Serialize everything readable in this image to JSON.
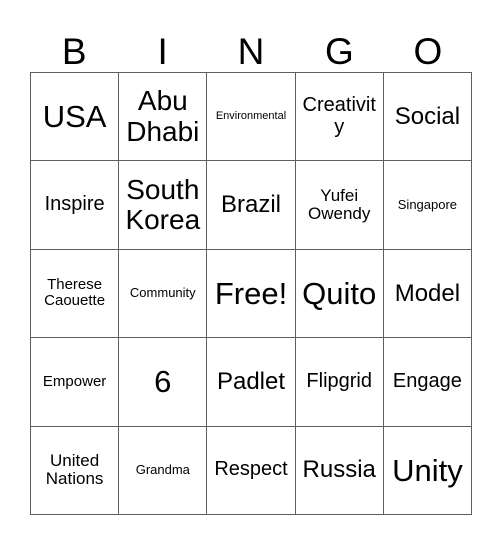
{
  "card": {
    "headers": [
      "B",
      "I",
      "N",
      "G",
      "O"
    ],
    "rows": [
      [
        {
          "text": "USA",
          "size": "fs-xxl"
        },
        {
          "text": "Abu Dhabi",
          "size": "fs-xl"
        },
        {
          "text": "Environmental",
          "size": "fs-tiny"
        },
        {
          "text": "Creativity",
          "size": "fs-md"
        },
        {
          "text": "Social",
          "size": "fs-lg"
        }
      ],
      [
        {
          "text": "Inspire",
          "size": "fs-md"
        },
        {
          "text": "South Korea",
          "size": "fs-xl"
        },
        {
          "text": "Brazil",
          "size": "fs-lg"
        },
        {
          "text": "Yufei Owendy",
          "size": "fs-sm"
        },
        {
          "text": "Singapore",
          "size": "fs-xxs"
        }
      ],
      [
        {
          "text": "Therese Caouette",
          "size": "fs-xs"
        },
        {
          "text": "Community",
          "size": "fs-xxs"
        },
        {
          "text": "Free!",
          "size": "fs-xxl"
        },
        {
          "text": "Quito",
          "size": "fs-xxl"
        },
        {
          "text": "Model",
          "size": "fs-lg"
        }
      ],
      [
        {
          "text": "Empower",
          "size": "fs-xs"
        },
        {
          "text": "6",
          "size": "fs-xxl"
        },
        {
          "text": "Padlet",
          "size": "fs-lg"
        },
        {
          "text": "Flipgrid",
          "size": "fs-md"
        },
        {
          "text": "Engage",
          "size": "fs-md"
        }
      ],
      [
        {
          "text": "United Nations",
          "size": "fs-sm"
        },
        {
          "text": "Grandma",
          "size": "fs-xxs"
        },
        {
          "text": "Respect",
          "size": "fs-md"
        },
        {
          "text": "Russia",
          "size": "fs-lg"
        },
        {
          "text": "Unity",
          "size": "fs-xxl"
        }
      ]
    ]
  }
}
